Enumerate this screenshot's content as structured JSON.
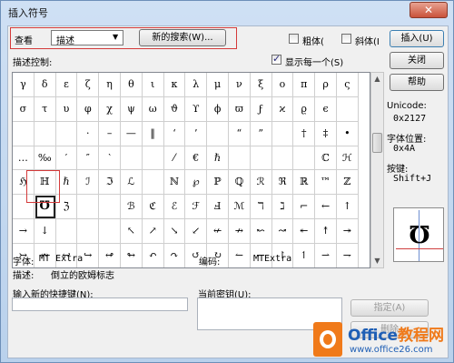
{
  "window": {
    "title": "插入符号",
    "close_glyph": "✕"
  },
  "view": {
    "label": "查看",
    "mode_value": "描述",
    "new_search_label": "新的搜索(W)..."
  },
  "toggles": {
    "bold_label": "粗体(",
    "italic_label": "斜体(I",
    "show_each_label": "显示每一个(S)",
    "show_each_checked": true
  },
  "buttons": {
    "insert": "插入(U)",
    "close": "关闭",
    "help": "帮助",
    "assign": "指定(A)",
    "remove": "删除"
  },
  "section": {
    "desc_control": "描述控制:"
  },
  "symbols": [
    [
      "γ",
      "δ",
      "ε",
      "ζ",
      "η",
      "θ",
      "ι",
      "κ",
      "λ",
      "μ",
      "ν",
      "ξ",
      "ο",
      "π",
      "ρ",
      "ς"
    ],
    [
      "σ",
      "τ",
      "υ",
      "φ",
      "χ",
      "ψ",
      "ω",
      "ϑ",
      "ϒ",
      "ϕ",
      "ϖ",
      "ϝ",
      "ϰ",
      "ϱ",
      "ϵ",
      ""
    ],
    [
      "",
      "",
      "",
      "·",
      "–",
      "—",
      "‖",
      "‘",
      "’",
      "",
      "“",
      "”",
      "",
      "†",
      "‡",
      "•"
    ],
    [
      "…",
      "‰",
      "′",
      "″",
      "‵",
      "",
      "",
      "⁄",
      "€",
      "ℏ",
      "",
      "",
      "",
      "",
      "ℂ",
      "ℋ"
    ],
    [
      "ℌ",
      "ℍ",
      "ℏ",
      "ℐ",
      "ℑ",
      "ℒ",
      "",
      "ℕ",
      "℘",
      "ℙ",
      "ℚ",
      "ℛ",
      "ℜ",
      "ℝ",
      "™",
      "ℤ"
    ],
    [
      "",
      "℧",
      "ℨ",
      "",
      "",
      "ℬ",
      "ℭ",
      "ℰ",
      "ℱ",
      "Ⅎ",
      "ℳ",
      "ℸ",
      "ℷ",
      "⌐",
      "←",
      "↑"
    ],
    [
      "→",
      "↓",
      "",
      "",
      "",
      "↖",
      "↗",
      "↘",
      "↙",
      "↚",
      "↛",
      "↜",
      "↝",
      "↞",
      "↟",
      "↠"
    ],
    [
      "↣",
      "↭",
      "↩",
      "↪",
      "↫",
      "↬",
      "↶",
      "↷",
      "↺",
      "↻",
      "↼",
      "↽",
      "↾",
      "↿",
      "⇀",
      "⇁"
    ]
  ],
  "selected_cell": {
    "row": 5,
    "col": 1
  },
  "info": {
    "unicode_label": "Unicode:",
    "unicode_value": "0x2127",
    "font_pos_label": "字体位置:",
    "font_pos_value": "0x4A",
    "key_label": "按键:",
    "key_value": "Shift+J",
    "preview_glyph": "℧"
  },
  "details": {
    "font_label": "字体:",
    "font_value": "MT Extra",
    "code_label": "编码:",
    "code_value": "MTExtra",
    "desc_label": "描述:",
    "desc_value": "倒立的欧姆标志"
  },
  "shortcut": {
    "new_label": "输入新的快捷键(N):",
    "current_label": "当前密钥(U):"
  },
  "watermark": {
    "brand_a": "Office",
    "brand_b": "教程网",
    "url": "www.office26.com"
  },
  "colors": {
    "accent_red": "#d43a3a",
    "watermark_orange": "#f07a1a",
    "watermark_blue": "#1f5fb5"
  }
}
